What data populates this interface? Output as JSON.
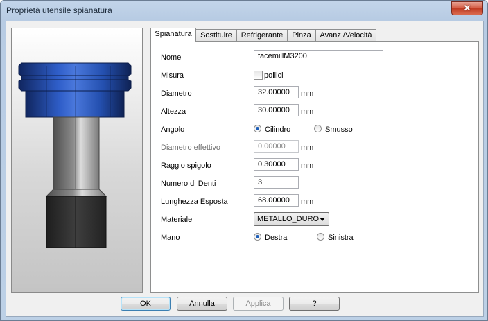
{
  "window": {
    "title": "Proprietà utensile spianatura",
    "close_glyph": "✕"
  },
  "tabs": [
    {
      "label": "Spianatura",
      "active": true
    },
    {
      "label": "Sostituire",
      "active": false
    },
    {
      "label": "Refrigerante",
      "active": false
    },
    {
      "label": "Pinza",
      "active": false
    },
    {
      "label": "Avanz./Velocità",
      "active": false
    }
  ],
  "form": {
    "nome": {
      "label": "Nome",
      "value": "facemillM3200"
    },
    "misura": {
      "label": "Misura",
      "checkbox_label": "pollici",
      "checked": false
    },
    "diametro": {
      "label": "Diametro",
      "value": "32.00000",
      "unit": "mm"
    },
    "altezza": {
      "label": "Altezza",
      "value": "30.00000",
      "unit": "mm"
    },
    "angolo": {
      "label": "Angolo",
      "option1": "Cilindro",
      "option2": "Smusso",
      "selected": "Cilindro"
    },
    "diametro_effettivo": {
      "label": "Diametro effettivo",
      "value": "0.00000",
      "unit": "mm"
    },
    "raggio_spigolo": {
      "label": "Raggio spigolo",
      "value": "0.30000",
      "unit": "mm"
    },
    "numero_denti": {
      "label": "Numero di Denti",
      "value": "3"
    },
    "lunghezza_esposta": {
      "label": "Lunghezza Esposta",
      "value": "68.00000",
      "unit": "mm"
    },
    "materiale": {
      "label": "Materiale",
      "value": "METALLO_DURO"
    },
    "mano": {
      "label": "Mano",
      "option1": "Destra",
      "option2": "Sinistra",
      "selected": "Destra"
    }
  },
  "buttons": {
    "ok": "OK",
    "cancel": "Annulla",
    "apply": "Applica",
    "help": "?"
  },
  "colors": {
    "tool_holder": "#2a56b8",
    "tool_shank": "#9a9a9a",
    "tool_cutter": "#3a3a3a"
  }
}
